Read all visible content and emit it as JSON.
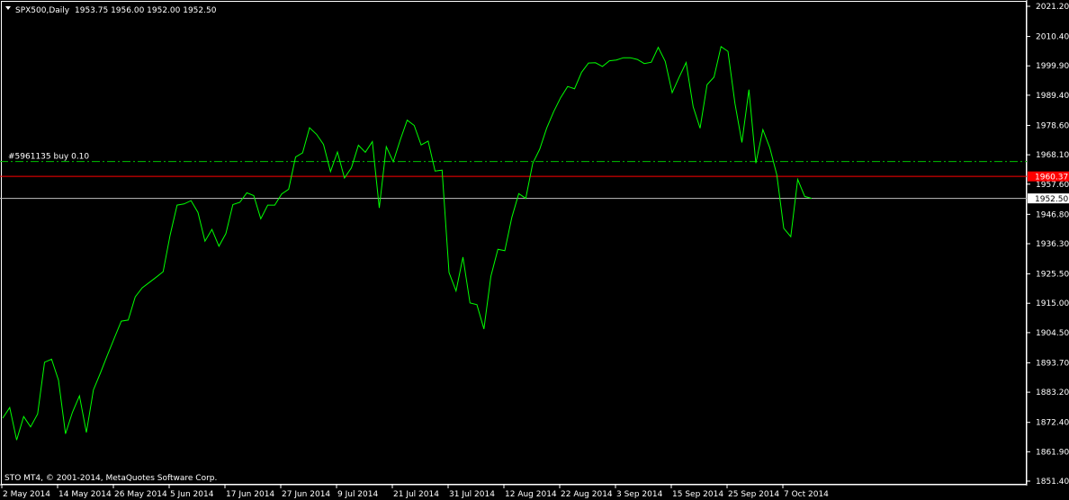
{
  "header": {
    "symbol": "SPX500,Daily",
    "ohlc": "1953.75 1956.00 1952.00 1952.50",
    "dropdown_icon": "triangle-down-icon"
  },
  "order_line": {
    "label": "#5961135 buy 0.10",
    "price": 1965.7,
    "color": "#00c000"
  },
  "current_price": {
    "value": 1952.5,
    "label": "1952.50",
    "color": "#c0c0c0"
  },
  "ask_price": {
    "value": 1960.37,
    "label": "1960.37",
    "color": "#ff0000"
  },
  "footer": {
    "copyright": "STO MT4, © 2001-2014, MetaQuotes Software Corp."
  },
  "colors": {
    "background": "#000000",
    "line": "#00ff00",
    "axis": "#ffffff",
    "grid_text": "#ffffff"
  },
  "chart_data": {
    "type": "line",
    "title": "",
    "xlabel": "",
    "ylabel": "",
    "ylim": [
      1851.4,
      2021.2
    ],
    "y_ticks": [
      "2021.20",
      "2010.40",
      "1999.90",
      "1989.40",
      "1978.60",
      "1968.10",
      "1957.60",
      "1946.80",
      "1936.30",
      "1925.50",
      "1915.00",
      "1904.50",
      "1893.70",
      "1883.20",
      "1872.40",
      "1861.90",
      "1851.40"
    ],
    "x_ticks": [
      "2 May 2014",
      "14 May 2014",
      "26 May 2014",
      "5 Jun 2014",
      "17 Jun 2014",
      "27 Jun 2014",
      "9 Jul 2014",
      "21 Jul 2014",
      "31 Jul 2014",
      "12 Aug 2014",
      "22 Aug 2014",
      "3 Sep 2014",
      "15 Sep 2014",
      "25 Sep 2014",
      "7 Oct 2014"
    ],
    "series": [
      {
        "values": [
          1873.9,
          1877.7,
          1866.1,
          1874.5,
          1870.8,
          1875.4,
          1893.9,
          1895.0,
          1887.5,
          1868.3,
          1876.0,
          1881.9,
          1868.8,
          1884.0,
          1890.0,
          1896.4,
          1902.5,
          1908.6,
          1909.0,
          1917.3,
          1920.5,
          1922.4,
          1924.3,
          1926.3,
          1939.3,
          1950.1,
          1950.5,
          1951.7,
          1947.5,
          1937.2,
          1941.4,
          1935.4,
          1939.9,
          1950.3,
          1951.1,
          1954.5,
          1953.5,
          1945.2,
          1950.1,
          1950.1,
          1954.1,
          1955.8,
          1967.3,
          1968.8,
          1977.8,
          1975.4,
          1971.8,
          1962.1,
          1969.1,
          1959.8,
          1963.4,
          1971.5,
          1969.0,
          1972.8,
          1949.1,
          1971.0,
          1965.6,
          1973.4,
          1980.5,
          1978.6,
          1971.6,
          1973.0,
          1962.3,
          1962.6,
          1926.0,
          1919.4,
          1931.5,
          1915.1,
          1914.5,
          1905.8,
          1924.6,
          1934.3,
          1933.8,
          1945.7,
          1954.2,
          1952.5,
          1965.0,
          1970.1,
          1977.6,
          1983.5,
          1988.5,
          1992.5,
          1991.7,
          1997.6,
          2000.9,
          2001.0,
          1999.7,
          2001.7,
          2002.0,
          2002.8,
          2002.8,
          2002.2,
          2000.7,
          2001.2,
          2006.5,
          2001.5,
          1990.3,
          1995.9,
          2001.1,
          1985.3,
          1977.6,
          1993.2,
          1995.9,
          2006.8,
          2005.1,
          1986.4,
          1972.5,
          1991.4,
          1965.1,
          1977.1,
          1970.6,
          1960.9,
          1941.8,
          1938.8,
          1959.3,
          1953.2,
          1952.5
        ]
      }
    ]
  }
}
